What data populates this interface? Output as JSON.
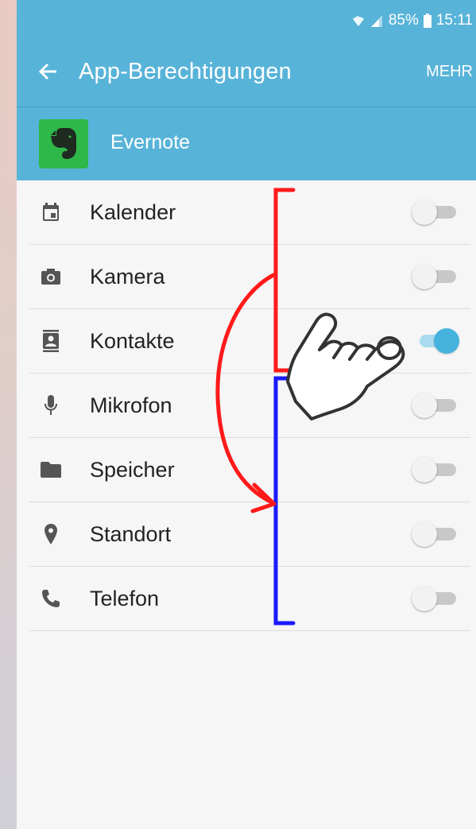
{
  "status_bar": {
    "battery": "85%",
    "time": "15:11",
    "icons": [
      "wifi-icon",
      "signal-icon",
      "battery-icon"
    ]
  },
  "app_bar": {
    "title": "App-Berechtigungen",
    "more_label": "MEHR"
  },
  "app": {
    "name": "Evernote",
    "logo_color": "#2fb84a"
  },
  "permissions": [
    {
      "label": "Kalender",
      "icon": "calendar-icon",
      "enabled": false
    },
    {
      "label": "Kamera",
      "icon": "camera-icon",
      "enabled": false
    },
    {
      "label": "Kontakte",
      "icon": "contacts-icon",
      "enabled": true
    },
    {
      "label": "Mikrofon",
      "icon": "microphone-icon",
      "enabled": false
    },
    {
      "label": "Speicher",
      "icon": "folder-icon",
      "enabled": false
    },
    {
      "label": "Standort",
      "icon": "location-icon",
      "enabled": false
    },
    {
      "label": "Telefon",
      "icon": "phone-icon",
      "enabled": false
    }
  ],
  "colors": {
    "accent": "#58b3d8",
    "switch_on": "#45b2de",
    "annotation_red": "#ff1a1a",
    "annotation_blue": "#1a1aff"
  }
}
